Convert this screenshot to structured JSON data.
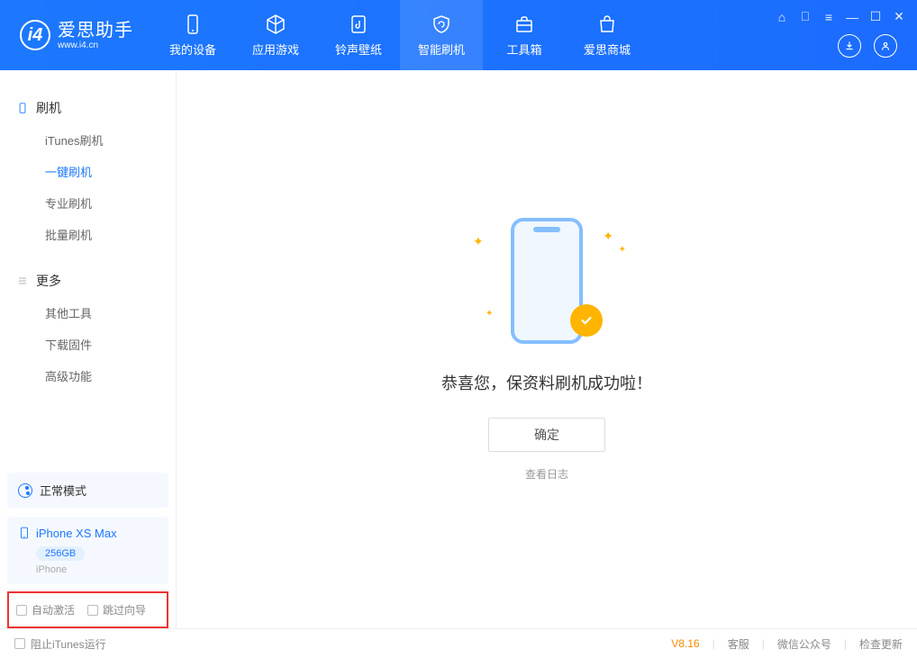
{
  "logo": {
    "name": "爱思助手",
    "url": "www.i4.cn"
  },
  "nav": [
    {
      "label": "我的设备"
    },
    {
      "label": "应用游戏"
    },
    {
      "label": "铃声壁纸"
    },
    {
      "label": "智能刷机"
    },
    {
      "label": "工具箱"
    },
    {
      "label": "爱思商城"
    }
  ],
  "sidebar": {
    "section1": {
      "head": "刷机",
      "items": [
        "iTunes刷机",
        "一键刷机",
        "专业刷机",
        "批量刷机"
      ]
    },
    "section2": {
      "head": "更多",
      "items": [
        "其他工具",
        "下载固件",
        "高级功能"
      ]
    }
  },
  "mode": {
    "label": "正常模式"
  },
  "device": {
    "name": "iPhone XS Max",
    "capacity": "256GB",
    "type": "iPhone"
  },
  "options": {
    "opt1": "自动激活",
    "opt2": "跳过向导"
  },
  "main": {
    "message": "恭喜您，保资料刷机成功啦！",
    "ok": "确定",
    "viewlog": "查看日志"
  },
  "footer": {
    "block_itunes": "阻止iTunes运行",
    "version": "V8.16",
    "links": [
      "客服",
      "微信公众号",
      "检查更新"
    ]
  }
}
